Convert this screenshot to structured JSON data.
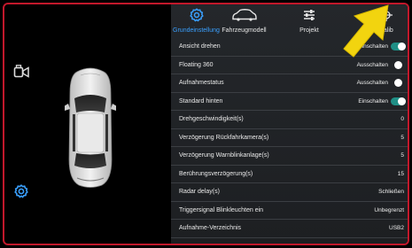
{
  "tabs": [
    {
      "label": "Grundeinstellung",
      "icon": "gear-icon",
      "active": true
    },
    {
      "label": "Fahrzeugmodell",
      "icon": "car-outline-icon",
      "active": false
    },
    {
      "label": "Projekt",
      "icon": "sliders-icon",
      "active": false
    },
    {
      "label": "Kalib",
      "icon": "crosshair-icon",
      "active": false
    }
  ],
  "settings": [
    {
      "label": "Ansicht drehen",
      "value": "Einschalten",
      "toggle": "on"
    },
    {
      "label": "Floating 360",
      "value": "Ausschalten",
      "toggle": "off"
    },
    {
      "label": "Aufnahmestatus",
      "value": "Ausschalten",
      "toggle": "off"
    },
    {
      "label": "Standard hinten",
      "value": "Einschalten",
      "toggle": "on"
    },
    {
      "label": "Drehgeschwindigkeit(s)",
      "value": "0"
    },
    {
      "label": "Verzögerung Rückfahrkamera(s)",
      "value": "5"
    },
    {
      "label": "Verzögerung Warnblinkanlage(s)",
      "value": "5"
    },
    {
      "label": "Berührungsverzögerung(s)",
      "value": "15"
    },
    {
      "label": "Radar delay(s)",
      "value": "Schließen"
    },
    {
      "label": "Triggersignal Blinkleuchten ein",
      "value": "Unbegrenzt"
    },
    {
      "label": "Aufnahme-Verzeichnis",
      "value": "USB2"
    }
  ],
  "colors": {
    "accent": "#3aa0ff",
    "frame": "#c2182b",
    "toggle_on": "#1f8f86",
    "arrow": "#f2d40f"
  },
  "icons": {
    "left_camera": "camera-switch-icon",
    "left_settings": "gear-icon",
    "overlay": "yellow-pointer-arrow"
  }
}
